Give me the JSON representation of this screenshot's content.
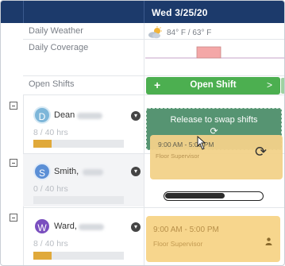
{
  "header": {
    "date": "Wed 3/25/20"
  },
  "summary_rows": {
    "weather_label": "Daily Weather",
    "weather_text": "84° F / 63° F",
    "weather_icon": "partly-sunny-icon",
    "coverage_label": "Daily Coverage",
    "open_shifts_label": "Open Shifts"
  },
  "open_shift_button": {
    "plus": "+",
    "label": "Open Shift",
    "chevron": ">"
  },
  "employees": [
    {
      "initial": "D",
      "name": "Dean",
      "hours": "8 / 40 hrs",
      "hours_fraction": 0.2
    },
    {
      "initial": "S",
      "name": "Smith,",
      "hours": "0 / 40 hrs",
      "hours_fraction": 0.0
    },
    {
      "initial": "W",
      "name": "Ward,",
      "hours": "8 / 40 hrs",
      "hours_fraction": 0.2
    }
  ],
  "drop_zone": {
    "label": "Release to swap shifts",
    "icon": "swap-icon"
  },
  "dragged_shift": {
    "time": "9:00 AM - 5:00 PM",
    "role": "Floor Supervisor"
  },
  "loading_progress": 0.62,
  "shift_card": {
    "time": "9:00 AM - 5:00 PM",
    "role": "Floor Supervisor",
    "icon": "person-icon"
  },
  "colors": {
    "header": "#1c3a6b",
    "open_shift_green": "#4caf50",
    "drop_zone_green": "#4e8f6b",
    "shift_yellow": "#f7d68d",
    "hours_fill": "#e0a93a"
  }
}
